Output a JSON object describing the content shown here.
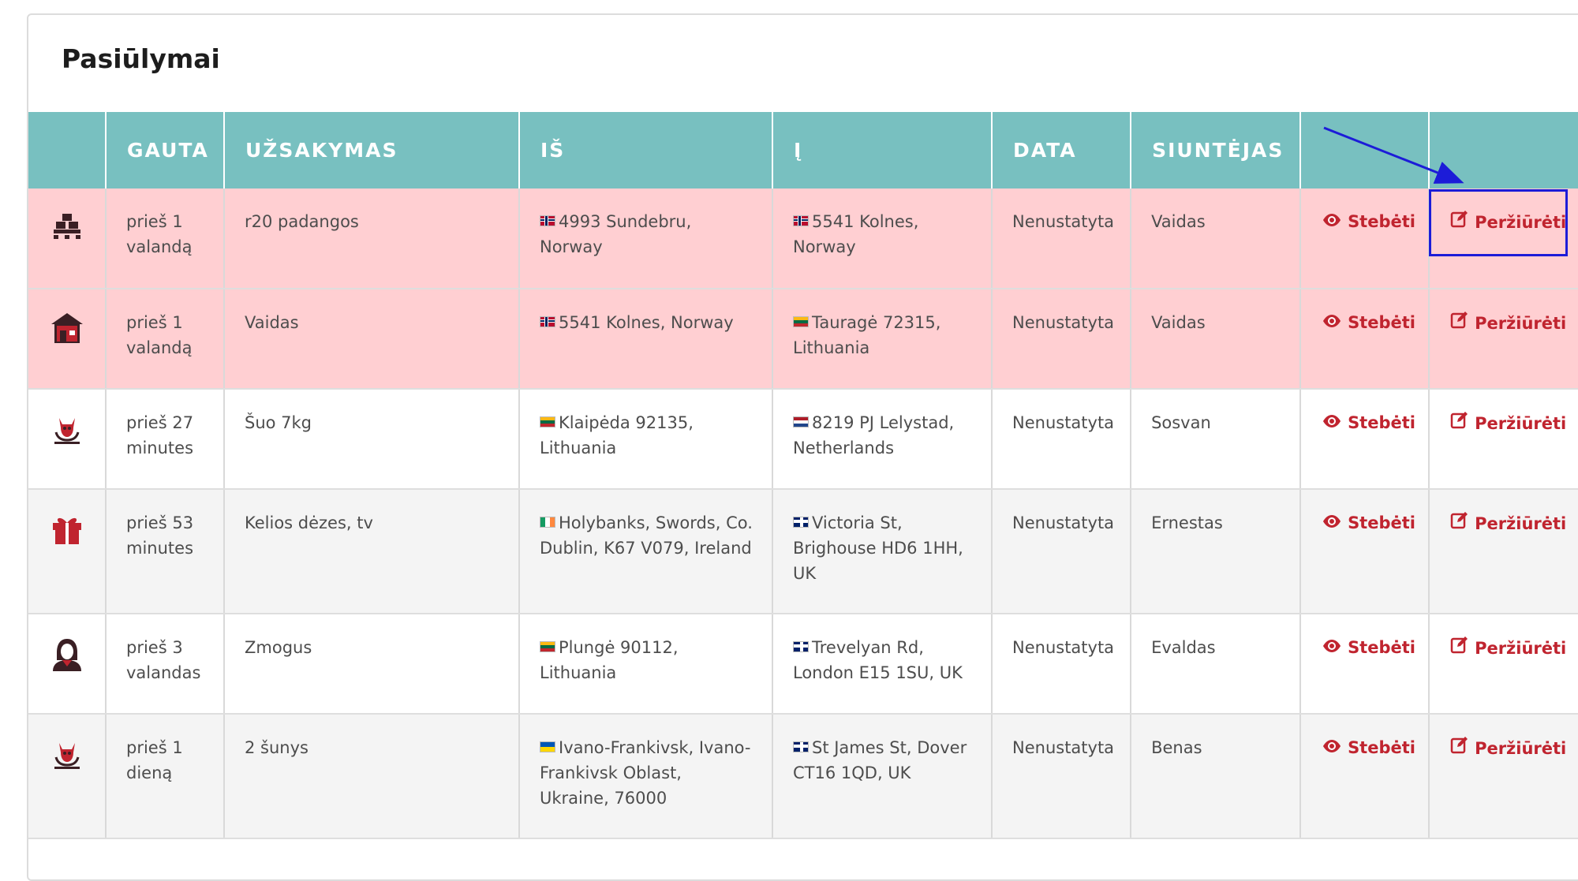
{
  "page_title": "Pasiūlymai",
  "columns": [
    "",
    "GAUTA",
    "UŽSAKYMAS",
    "IŠ",
    "Į",
    "DATA",
    "SIUNTĖJAS",
    "",
    ""
  ],
  "actions": {
    "watch_label": "Stebėti",
    "view_label": "Peržiūrėti"
  },
  "rows": [
    {
      "category_icon": "pallet-icon",
      "received": "prieš 1 valandą",
      "order": "r20 padangos",
      "from": "4993 Sundebru, Norway",
      "from_flag": "norway-flag",
      "to": "5541 Kolnes, Norway",
      "to_flag": "norway-flag",
      "date": "Nenustatyta",
      "sender": "Vaidas",
      "highlighted": true
    },
    {
      "category_icon": "house-icon",
      "received": "prieš 1 valandą",
      "order": "Vaidas",
      "from": "5541 Kolnes, Norway",
      "from_flag": "norway-flag",
      "to": "Tauragė 72315, Lithuania",
      "to_flag": "lithuania-flag",
      "date": "Nenustatyta",
      "sender": "Vaidas",
      "highlighted": true
    },
    {
      "category_icon": "pet-icon",
      "received": "prieš 27 minutes",
      "order": "Šuo 7kg",
      "from": "Klaipėda 92135, Lithuania",
      "from_flag": "lithuania-flag",
      "to": "8219 PJ Lelystad, Netherlands",
      "to_flag": "netherlands-flag",
      "date": "Nenustatyta",
      "sender": "Sosvan",
      "highlighted": false
    },
    {
      "category_icon": "gift-icon",
      "received": "prieš 53 minutes",
      "order": "Kelios dėzes, tv",
      "from": "Holybanks, Swords, Co. Dublin, K67 V079, Ireland",
      "from_flag": "ireland-flag",
      "to": "Victoria St, Brighouse HD6 1HH, UK",
      "to_flag": "uk-flag",
      "date": "Nenustatyta",
      "sender": "Ernestas",
      "highlighted": false
    },
    {
      "category_icon": "person-icon",
      "received": "prieš 3 valandas",
      "order": "Zmogus",
      "from": "Plungė 90112, Lithuania",
      "from_flag": "lithuania-flag",
      "to": "Trevelyan Rd, London E15 1SU, UK",
      "to_flag": "uk-flag",
      "date": "Nenustatyta",
      "sender": "Evaldas",
      "highlighted": false
    },
    {
      "category_icon": "pet-icon",
      "received": "prieš 1 dieną",
      "order": "2 šunys",
      "from": "Ivano-Frankivsk, Ivano-Frankivsk Oblast, Ukraine, 76000",
      "from_flag": "ukraine-flag",
      "to": "St James St, Dover CT16 1QD, UK",
      "to_flag": "uk-flag",
      "date": "Nenustatyta",
      "sender": "Benas",
      "highlighted": false
    }
  ],
  "colors": {
    "header": "#78c0c0",
    "highlight_row": "#ffcfd2",
    "action": "#c0242f",
    "annotation": "#1c1cd8"
  }
}
